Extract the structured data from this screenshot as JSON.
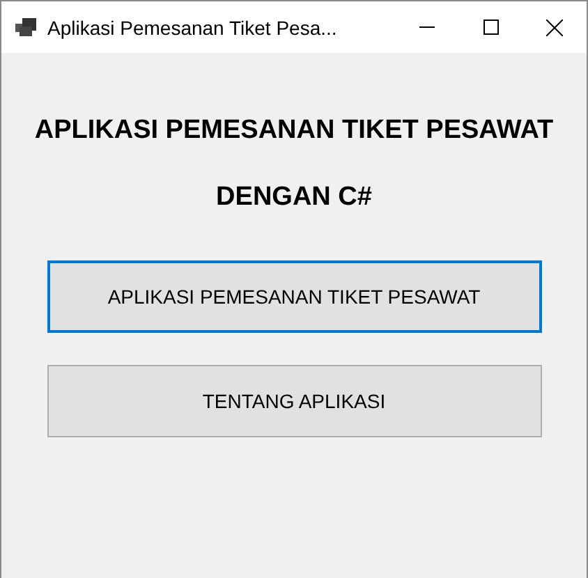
{
  "window": {
    "title": "Aplikasi Pemesanan Tiket Pesa..."
  },
  "headings": [
    "APLIKASI PEMESANAN TIKET PESAWAT",
    "DENGAN C#"
  ],
  "buttons": [
    {
      "label": "APLIKASI PEMESANAN TIKET PESAWAT",
      "focused": true
    },
    {
      "label": "TENTANG APLIKASI",
      "focused": false
    }
  ]
}
